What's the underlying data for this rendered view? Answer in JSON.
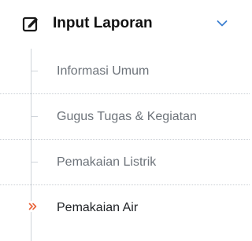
{
  "menu": {
    "title": "Input Laporan",
    "icon": "edit-icon",
    "chevron": "chevron-down-icon",
    "expanded": true,
    "accent_color": "#3b7fd0",
    "active_marker_color": "#e8643a",
    "items": [
      {
        "label": "Informasi Umum",
        "active": false
      },
      {
        "label": "Gugus Tugas & Kegiatan",
        "active": false
      },
      {
        "label": "Pemakaian Listrik",
        "active": false
      },
      {
        "label": "Pemakaian Air",
        "active": true,
        "marker_icon": "double-chevron-right-icon"
      }
    ]
  }
}
